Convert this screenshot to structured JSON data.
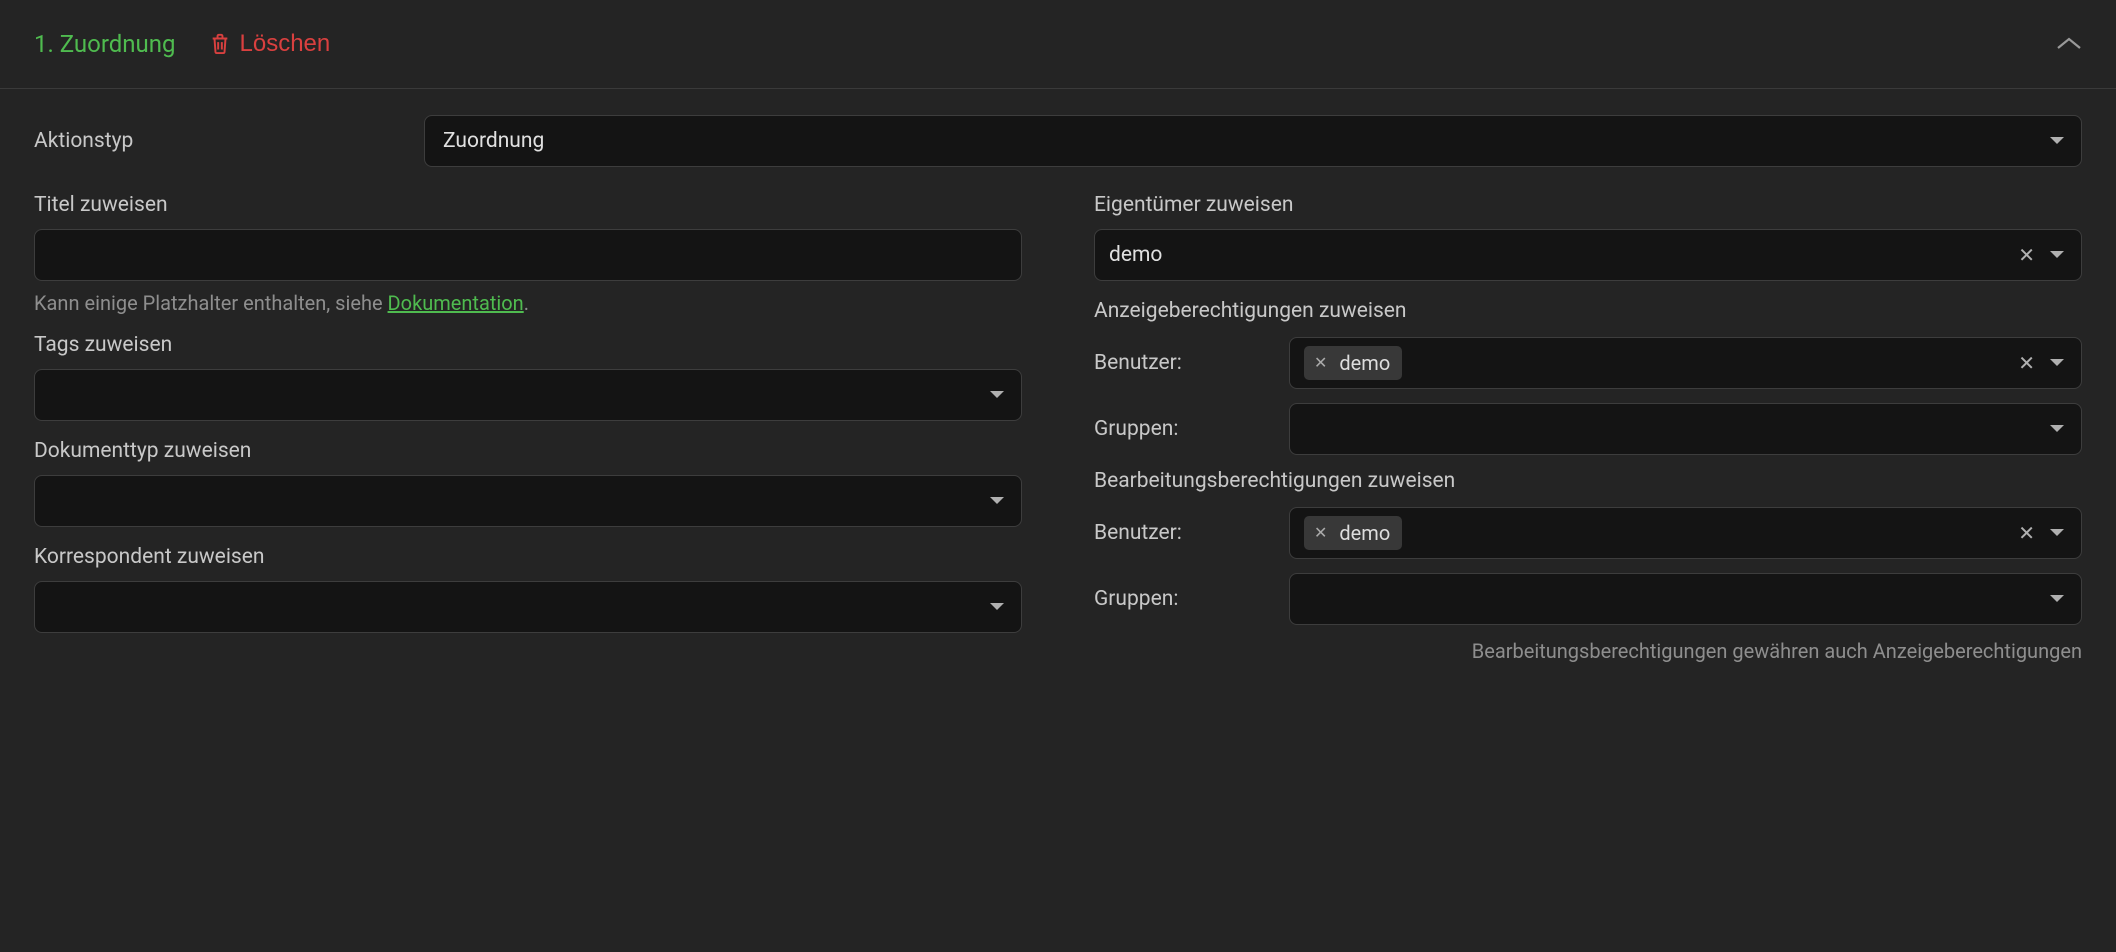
{
  "header": {
    "title": "1. Zuordnung",
    "delete_label": "Löschen"
  },
  "action_type": {
    "label": "Aktionstyp",
    "value": "Zuordnung"
  },
  "left": {
    "title": {
      "label": "Titel zuweisen",
      "value": "",
      "hint_prefix": "Kann einige Platzhalter enthalten, siehe ",
      "hint_link": "Dokumentation",
      "hint_suffix": "."
    },
    "tags": {
      "label": "Tags zuweisen"
    },
    "doctype": {
      "label": "Dokumenttyp zuweisen"
    },
    "correspondent": {
      "label": "Korrespondent zuweisen"
    }
  },
  "right": {
    "owner": {
      "label": "Eigentümer zuweisen",
      "value": "demo"
    },
    "view_perms": {
      "label": "Anzeigeberechtigungen zuweisen",
      "users_label": "Benutzer:",
      "users_chip": "demo",
      "groups_label": "Gruppen:"
    },
    "edit_perms": {
      "label": "Bearbeitungsberechtigungen zuweisen",
      "users_label": "Benutzer:",
      "users_chip": "demo",
      "groups_label": "Gruppen:",
      "note": "Bearbeitungsberechtigungen gewähren auch Anzeigeberechtigungen"
    }
  }
}
